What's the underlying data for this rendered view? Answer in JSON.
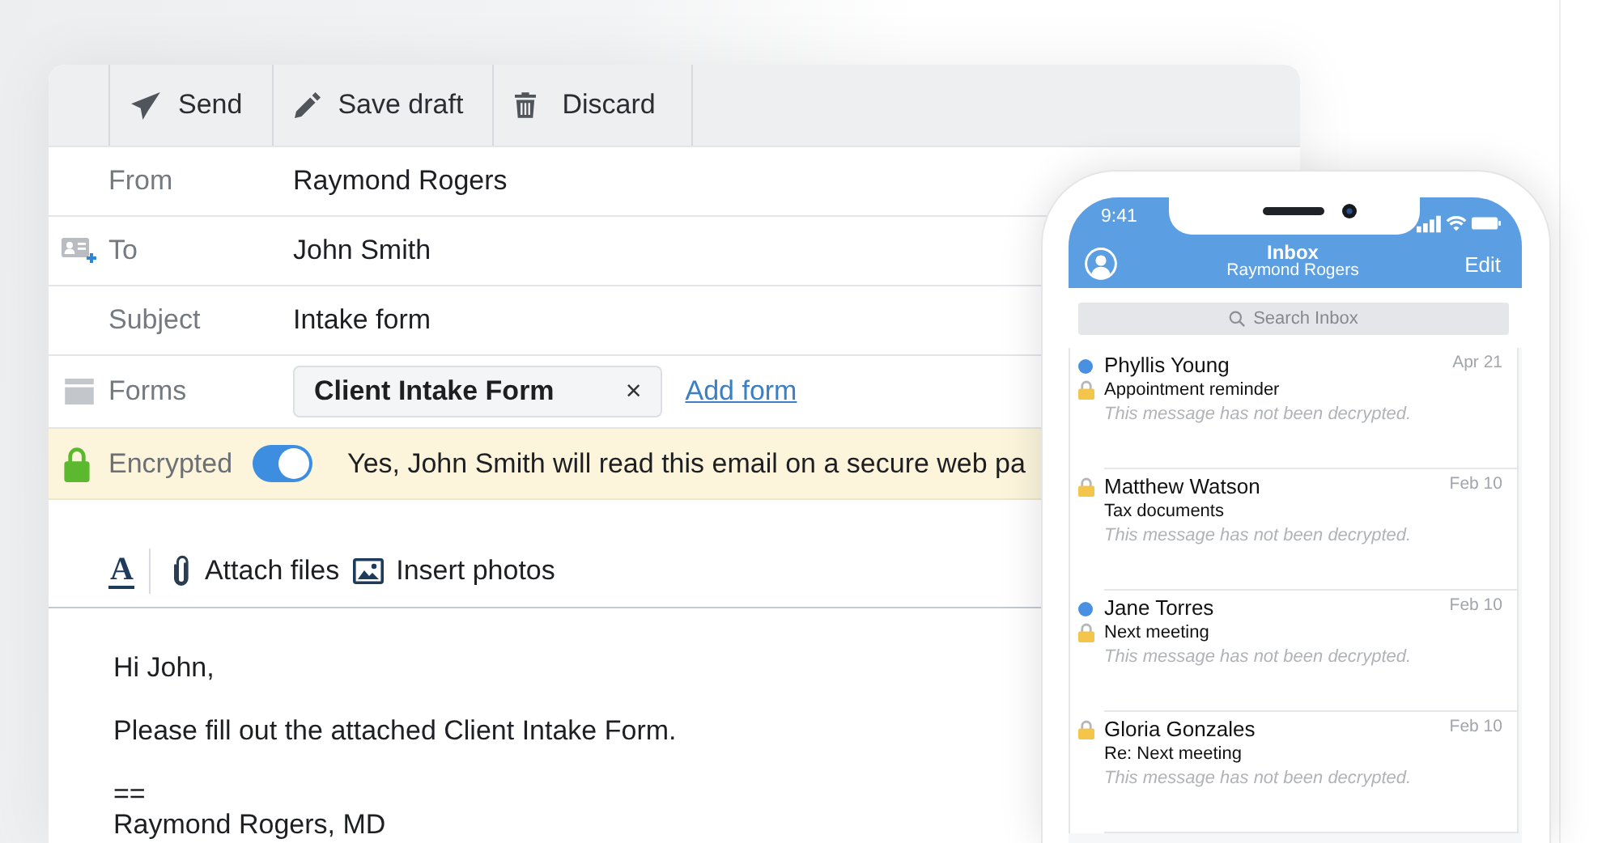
{
  "compose": {
    "toolbar": [
      {
        "kind": "send",
        "label": "Send"
      },
      {
        "kind": "draft",
        "label": "Save draft"
      },
      {
        "kind": "discard",
        "label": "Discard"
      }
    ],
    "fields": [
      {
        "kind": "from",
        "label": "From",
        "value": "Raymond Rogers"
      },
      {
        "kind": "to",
        "label": "To",
        "value": "John Smith"
      },
      {
        "kind": "subject",
        "label": "Subject",
        "value": "Intake form"
      }
    ],
    "forms": {
      "label": "Forms",
      "chips": [
        {
          "label": "Client Intake Form",
          "remove": "×"
        }
      ],
      "add_link": "Add form"
    },
    "encryption": {
      "label": "Encrypted",
      "on": true,
      "notice": "Yes, John Smith will read this email on a secure web pa"
    },
    "format_bar": {
      "text_format": "A",
      "attach": "Attach files",
      "insert_photos": "Insert photos"
    },
    "body": [
      [
        "Hi John,"
      ],
      [
        "Please fill out the attached Client Intake Form."
      ],
      [
        "==",
        "Raymond Rogers, MD"
      ]
    ]
  },
  "phone": {
    "status_bar": {
      "time": "9:41"
    },
    "header": {
      "title": "Inbox",
      "subtitle": "Raymond Rogers",
      "action": "Edit"
    },
    "search": {
      "placeholder": "Search Inbox"
    },
    "messages": [
      {
        "sender": "Phyllis Young",
        "date": "Apr 21",
        "subject": "Appointment reminder",
        "preview": "This message has not been decrypted.",
        "unread": true
      },
      {
        "sender": "Matthew Watson",
        "date": "Feb 10",
        "subject": "Tax documents",
        "preview": "This message has not been decrypted.",
        "unread": false
      },
      {
        "sender": "Jane Torres",
        "date": "Feb 10",
        "subject": "Next meeting",
        "preview": "This message has not been decrypted.",
        "unread": true
      },
      {
        "sender": "Gloria Gonzales",
        "date": "Feb 10",
        "subject": "Re: Next meeting",
        "preview": "This message has not been decrypted.",
        "unread": false
      }
    ]
  }
}
